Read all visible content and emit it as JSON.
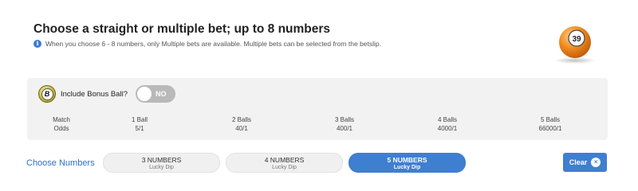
{
  "header": {
    "title": "Choose a straight or multiple bet; up to 8 numbers",
    "info_icon": "info-icon",
    "info_text": "When you choose 6 - 8 numbers, only Multiple bets are available. Multiple bets can be selected from the betslip."
  },
  "lotto_ball": {
    "number": "39",
    "color": "#f08a1e"
  },
  "bonus": {
    "badge_letter": "B",
    "label": "Include Bonus Ball?",
    "toggle_text": "NO"
  },
  "odds": {
    "columns": [
      {
        "match": "Match",
        "odds": "Odds"
      },
      {
        "match": "1 Ball",
        "odds": "5/1"
      },
      {
        "match": "2 Balls",
        "odds": "40/1"
      },
      {
        "match": "3 Balls",
        "odds": "400/1"
      },
      {
        "match": "4 Balls",
        "odds": "4000/1"
      },
      {
        "match": "5 Balls",
        "odds": "66000/1"
      }
    ]
  },
  "choose": {
    "label": "Choose Numbers",
    "options": [
      {
        "main": "3 NUMBERS",
        "sub": "Lucky Dip",
        "selected": false
      },
      {
        "main": "4 NUMBERS",
        "sub": "Lucky Dip",
        "selected": false
      },
      {
        "main": "5 NUMBERS",
        "sub": "Lucky Dip",
        "selected": true
      }
    ]
  },
  "clear": {
    "label": "Clear",
    "icon": "close-icon"
  },
  "colors": {
    "accent": "#3f7fd0",
    "toggle_off": "#b9b9b9",
    "panel_bg": "#f2f2f2"
  }
}
